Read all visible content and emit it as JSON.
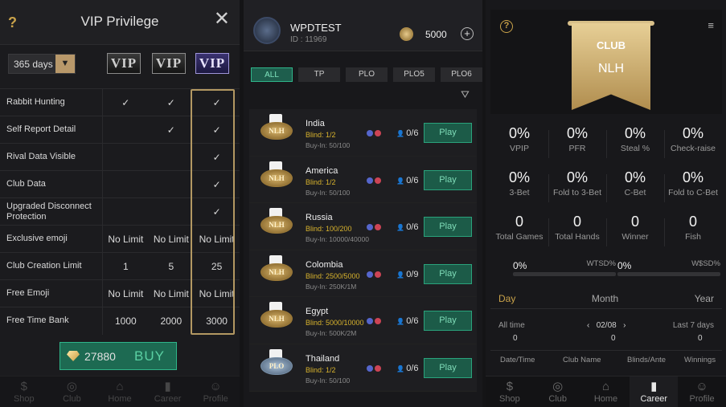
{
  "vip": {
    "title": "VIP Privilege",
    "close": "✕",
    "period": "365 days",
    "badges": [
      "VIP",
      "VIP",
      "VIP"
    ],
    "rows": [
      {
        "label": "Rabbit Hunting",
        "v": [
          "✓",
          "✓",
          "✓"
        ]
      },
      {
        "label": "Self Report Detail",
        "v": [
          "",
          "✓",
          "✓"
        ]
      },
      {
        "label": "Rival Data Visible",
        "v": [
          "",
          "",
          "✓"
        ]
      },
      {
        "label": "Club Data",
        "v": [
          "",
          "",
          "✓"
        ]
      },
      {
        "label": "Upgraded Disconnect Protection",
        "v": [
          "",
          "",
          "✓"
        ]
      },
      {
        "label": "Exclusive emoji",
        "v": [
          "No Limit",
          "No Limit",
          "No Limit"
        ]
      },
      {
        "label": "Club Creation Limit",
        "v": [
          "1",
          "5",
          "25"
        ]
      },
      {
        "label": "Free Emoji",
        "v": [
          "No Limit",
          "No Limit",
          "No Limit"
        ]
      },
      {
        "label": "Free Time Bank",
        "v": [
          "1000",
          "2000",
          "3000"
        ]
      }
    ],
    "buy": {
      "amount": "27880",
      "label": "BUY"
    }
  },
  "nav": [
    "Shop",
    "Club",
    "Home",
    "Career",
    "Profile"
  ],
  "lobby": {
    "user": "WPDTEST",
    "id": "ID : 11969",
    "coins": "5000",
    "tabs": [
      "ALL",
      "TP",
      "PLO",
      "PLO5",
      "PLO6"
    ],
    "tables": [
      {
        "name": "India",
        "blind": "Blind: 1/2",
        "buyin": "Buy-In: 50/100",
        "players": "0/6",
        "type": "NLH"
      },
      {
        "name": "America",
        "blind": "Blind: 1/2",
        "buyin": "Buy-In: 50/100",
        "players": "0/6",
        "type": "NLH"
      },
      {
        "name": "Russia",
        "blind": "Blind: 100/200",
        "buyin": "Buy-In: 10000/40000",
        "players": "0/6",
        "type": "NLH"
      },
      {
        "name": "Colombia",
        "blind": "Blind: 2500/5000",
        "buyin": "Buy-In: 250K/1M",
        "players": "0/9",
        "type": "NLH"
      },
      {
        "name": "Egypt",
        "blind": "Blind: 5000/10000",
        "buyin": "Buy-In: 500K/2M",
        "players": "0/6",
        "type": "NLH"
      },
      {
        "name": "Thailand",
        "blind": "Blind: 1/2",
        "buyin": "Buy-In: 50/100",
        "players": "0/6",
        "type": "PLO"
      }
    ],
    "play": "Play"
  },
  "career": {
    "club": "CLUB",
    "game": "NLH",
    "stats": [
      [
        {
          "v": "0%",
          "l": "VPIP"
        },
        {
          "v": "0%",
          "l": "PFR"
        },
        {
          "v": "0%",
          "l": "Steal %"
        },
        {
          "v": "0%",
          "l": "Check-raise"
        }
      ],
      [
        {
          "v": "0%",
          "l": "3-Bet"
        },
        {
          "v": "0%",
          "l": "Fold to 3-Bet"
        },
        {
          "v": "0%",
          "l": "C-Bet"
        },
        {
          "v": "0%",
          "l": "Fold to C-Bet"
        }
      ],
      [
        {
          "v": "0",
          "l": "Total Games"
        },
        {
          "v": "0",
          "l": "Total Hands"
        },
        {
          "v": "0",
          "l": "Winner"
        },
        {
          "v": "0",
          "l": "Fish"
        }
      ]
    ],
    "wtsd": {
      "v": "0%",
      "l": "WTSD%"
    },
    "wsd": {
      "v": "0%",
      "l": "W$SD%"
    },
    "tabs": [
      "Day",
      "Month",
      "Year"
    ],
    "period": {
      "all": "All time",
      "date": "02/08",
      "last": "Last 7 days",
      "z1": "0",
      "z2": "0",
      "z3": "0"
    },
    "cols": [
      "Date/Time",
      "Club Name",
      "Blinds/Ante",
      "Winnings"
    ]
  }
}
